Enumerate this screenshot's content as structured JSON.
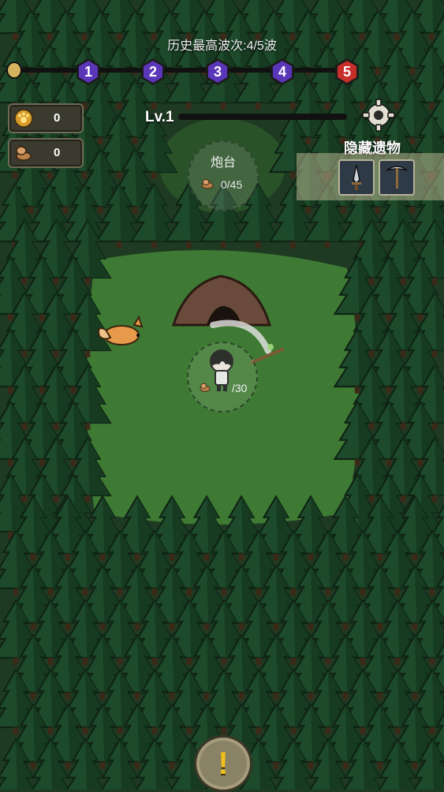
{
  "hud": {
    "wave_record": "历史最高波次:4/5波",
    "waves": [
      {
        "label": "1",
        "color": "#5a36b8"
      },
      {
        "label": "2",
        "color": "#5a36b8"
      },
      {
        "label": "3",
        "color": "#5a36b8"
      },
      {
        "label": "4",
        "color": "#5a36b8"
      },
      {
        "label": "5",
        "color": "#c7302a"
      }
    ],
    "resources": [
      {
        "name": "paw-coin-icon",
        "value": "0"
      },
      {
        "name": "wood-log-icon",
        "value": "0"
      }
    ],
    "level": "Lv.1",
    "relics_title": "隐藏遗物",
    "relics": [
      {
        "name": "dagger-icon"
      },
      {
        "name": "pickaxe-icon"
      }
    ]
  },
  "world": {
    "turret_label": "炮台",
    "turret_progress": "0/45",
    "player_wood": "/30"
  },
  "colors": {
    "grass": "#3e7a33",
    "forest": "#1f3a22",
    "tree": "#1d4a2a",
    "accent_purple": "#5a36b8",
    "accent_red": "#c7302a"
  }
}
